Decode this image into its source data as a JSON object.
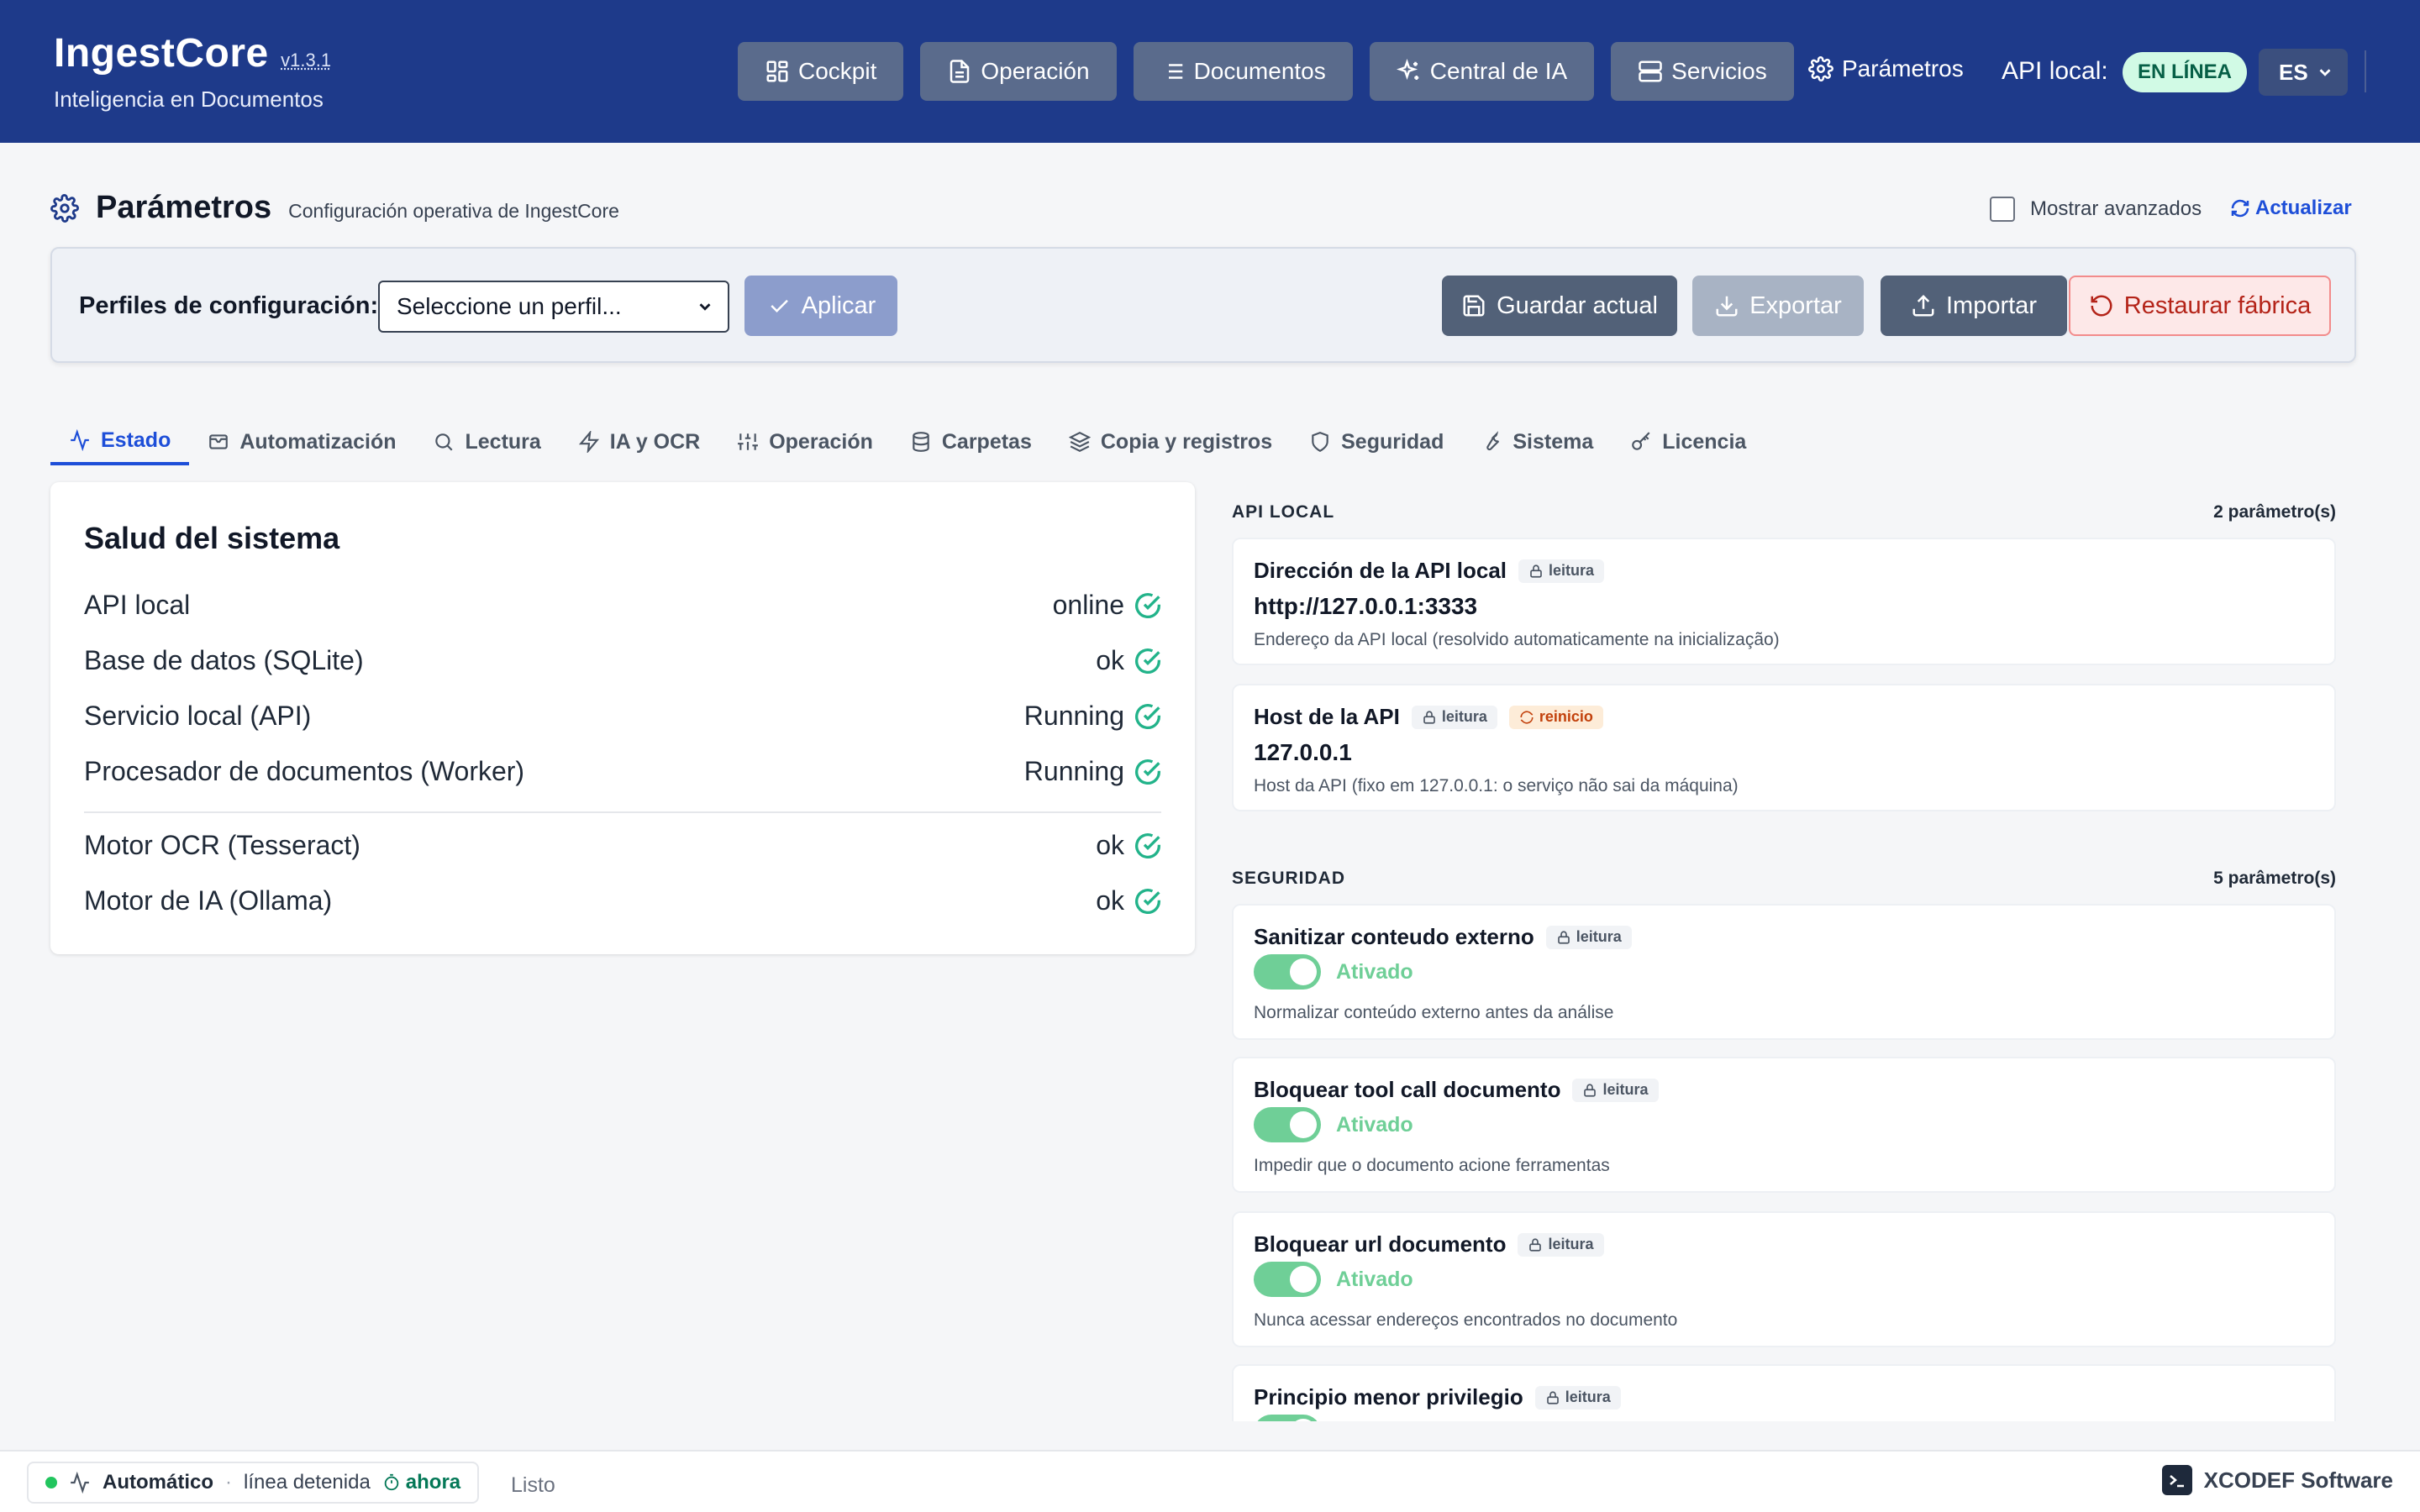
{
  "header": {
    "app_name": "IngestCore",
    "version": "v1.3.1",
    "tagline": "Inteligencia en Documentos",
    "nav": [
      {
        "label": "Cockpit",
        "icon": "dashboard-icon"
      },
      {
        "label": "Operación",
        "icon": "document-icon"
      },
      {
        "label": "Documentos",
        "icon": "list-icon"
      },
      {
        "label": "Central de IA",
        "icon": "sparkles-icon"
      },
      {
        "label": "Servicios",
        "icon": "server-icon"
      }
    ],
    "settings_label": "Parámetros",
    "api_label": "API local:",
    "api_status": "EN LÍNEA",
    "language": "ES"
  },
  "page": {
    "title": "Parámetros",
    "subtitle": "Configuración operativa de IngestCore",
    "show_advanced": "Mostrar avanzados",
    "refresh": "Actualizar"
  },
  "profiles": {
    "label": "Perfiles de configuración:",
    "select_placeholder": "Seleccione un perfil...",
    "apply": "Aplicar",
    "save": "Guardar actual",
    "export": "Exportar",
    "import": "Importar",
    "reset": "Restaurar fábrica"
  },
  "tabs": [
    {
      "label": "Estado",
      "icon": "activity-icon",
      "active": true
    },
    {
      "label": "Automatización",
      "icon": "inbox-icon"
    },
    {
      "label": "Lectura",
      "icon": "search-icon"
    },
    {
      "label": "IA y OCR",
      "icon": "lightning-icon"
    },
    {
      "label": "Operación",
      "icon": "sliders-icon"
    },
    {
      "label": "Carpetas",
      "icon": "database-icon"
    },
    {
      "label": "Copia y registros",
      "icon": "layers-icon"
    },
    {
      "label": "Seguridad",
      "icon": "shield-icon"
    },
    {
      "label": "Sistema",
      "icon": "wrench-icon"
    },
    {
      "label": "Licencia",
      "icon": "key-icon"
    }
  ],
  "health": {
    "title": "Salud del sistema",
    "rows": [
      {
        "label": "API local",
        "value": "online"
      },
      {
        "label": "Base de datos (SQLite)",
        "value": "ok"
      },
      {
        "label": "Servicio local (API)",
        "value": "Running"
      },
      {
        "label": "Procesador de documentos (Worker)",
        "value": "Running"
      },
      {
        "label": "Motor OCR (Tesseract)",
        "value": "ok"
      },
      {
        "label": "Motor de IA (Ollama)",
        "value": "ok"
      }
    ]
  },
  "sections": {
    "api_local": {
      "title": "API LOCAL",
      "count": "2 parâmetro(s)",
      "params": [
        {
          "title": "Dirección de la API local",
          "chip": "leitura",
          "value": "http://127.0.0.1:3333",
          "desc": "Endereço da API local (resolvido automaticamente na inicialização)"
        },
        {
          "title": "Host de la API",
          "chip": "leitura",
          "chip2": "reinicio",
          "value": "127.0.0.1",
          "desc": "Host da API (fixo em 127.0.0.1: o serviço não sai da máquina)"
        }
      ]
    },
    "seguridad": {
      "title": "SEGURIDAD",
      "count": "5 parâmetro(s)",
      "params": [
        {
          "title": "Sanitizar conteudo externo",
          "chip": "leitura",
          "toggle": "Ativado",
          "desc": "Normalizar conteúdo externo antes da análise"
        },
        {
          "title": "Bloquear tool call documento",
          "chip": "leitura",
          "toggle": "Ativado",
          "desc": "Impedir que o documento acione ferramentas"
        },
        {
          "title": "Bloquear url documento",
          "chip": "leitura",
          "toggle": "Ativado",
          "desc": "Nunca acessar endereços encontrados no documento"
        },
        {
          "title": "Principio menor privilegio",
          "chip": "leitura"
        }
      ]
    }
  },
  "footer": {
    "mode": "Automático",
    "line": "línea detenida",
    "time": "ahora",
    "status": "Listo",
    "vendor": "XCODEF Software"
  },
  "colors": {
    "header_bg": "#1e3a8a",
    "accent": "#1d4ed8",
    "success": "#22b38a",
    "danger": "#b42318"
  }
}
